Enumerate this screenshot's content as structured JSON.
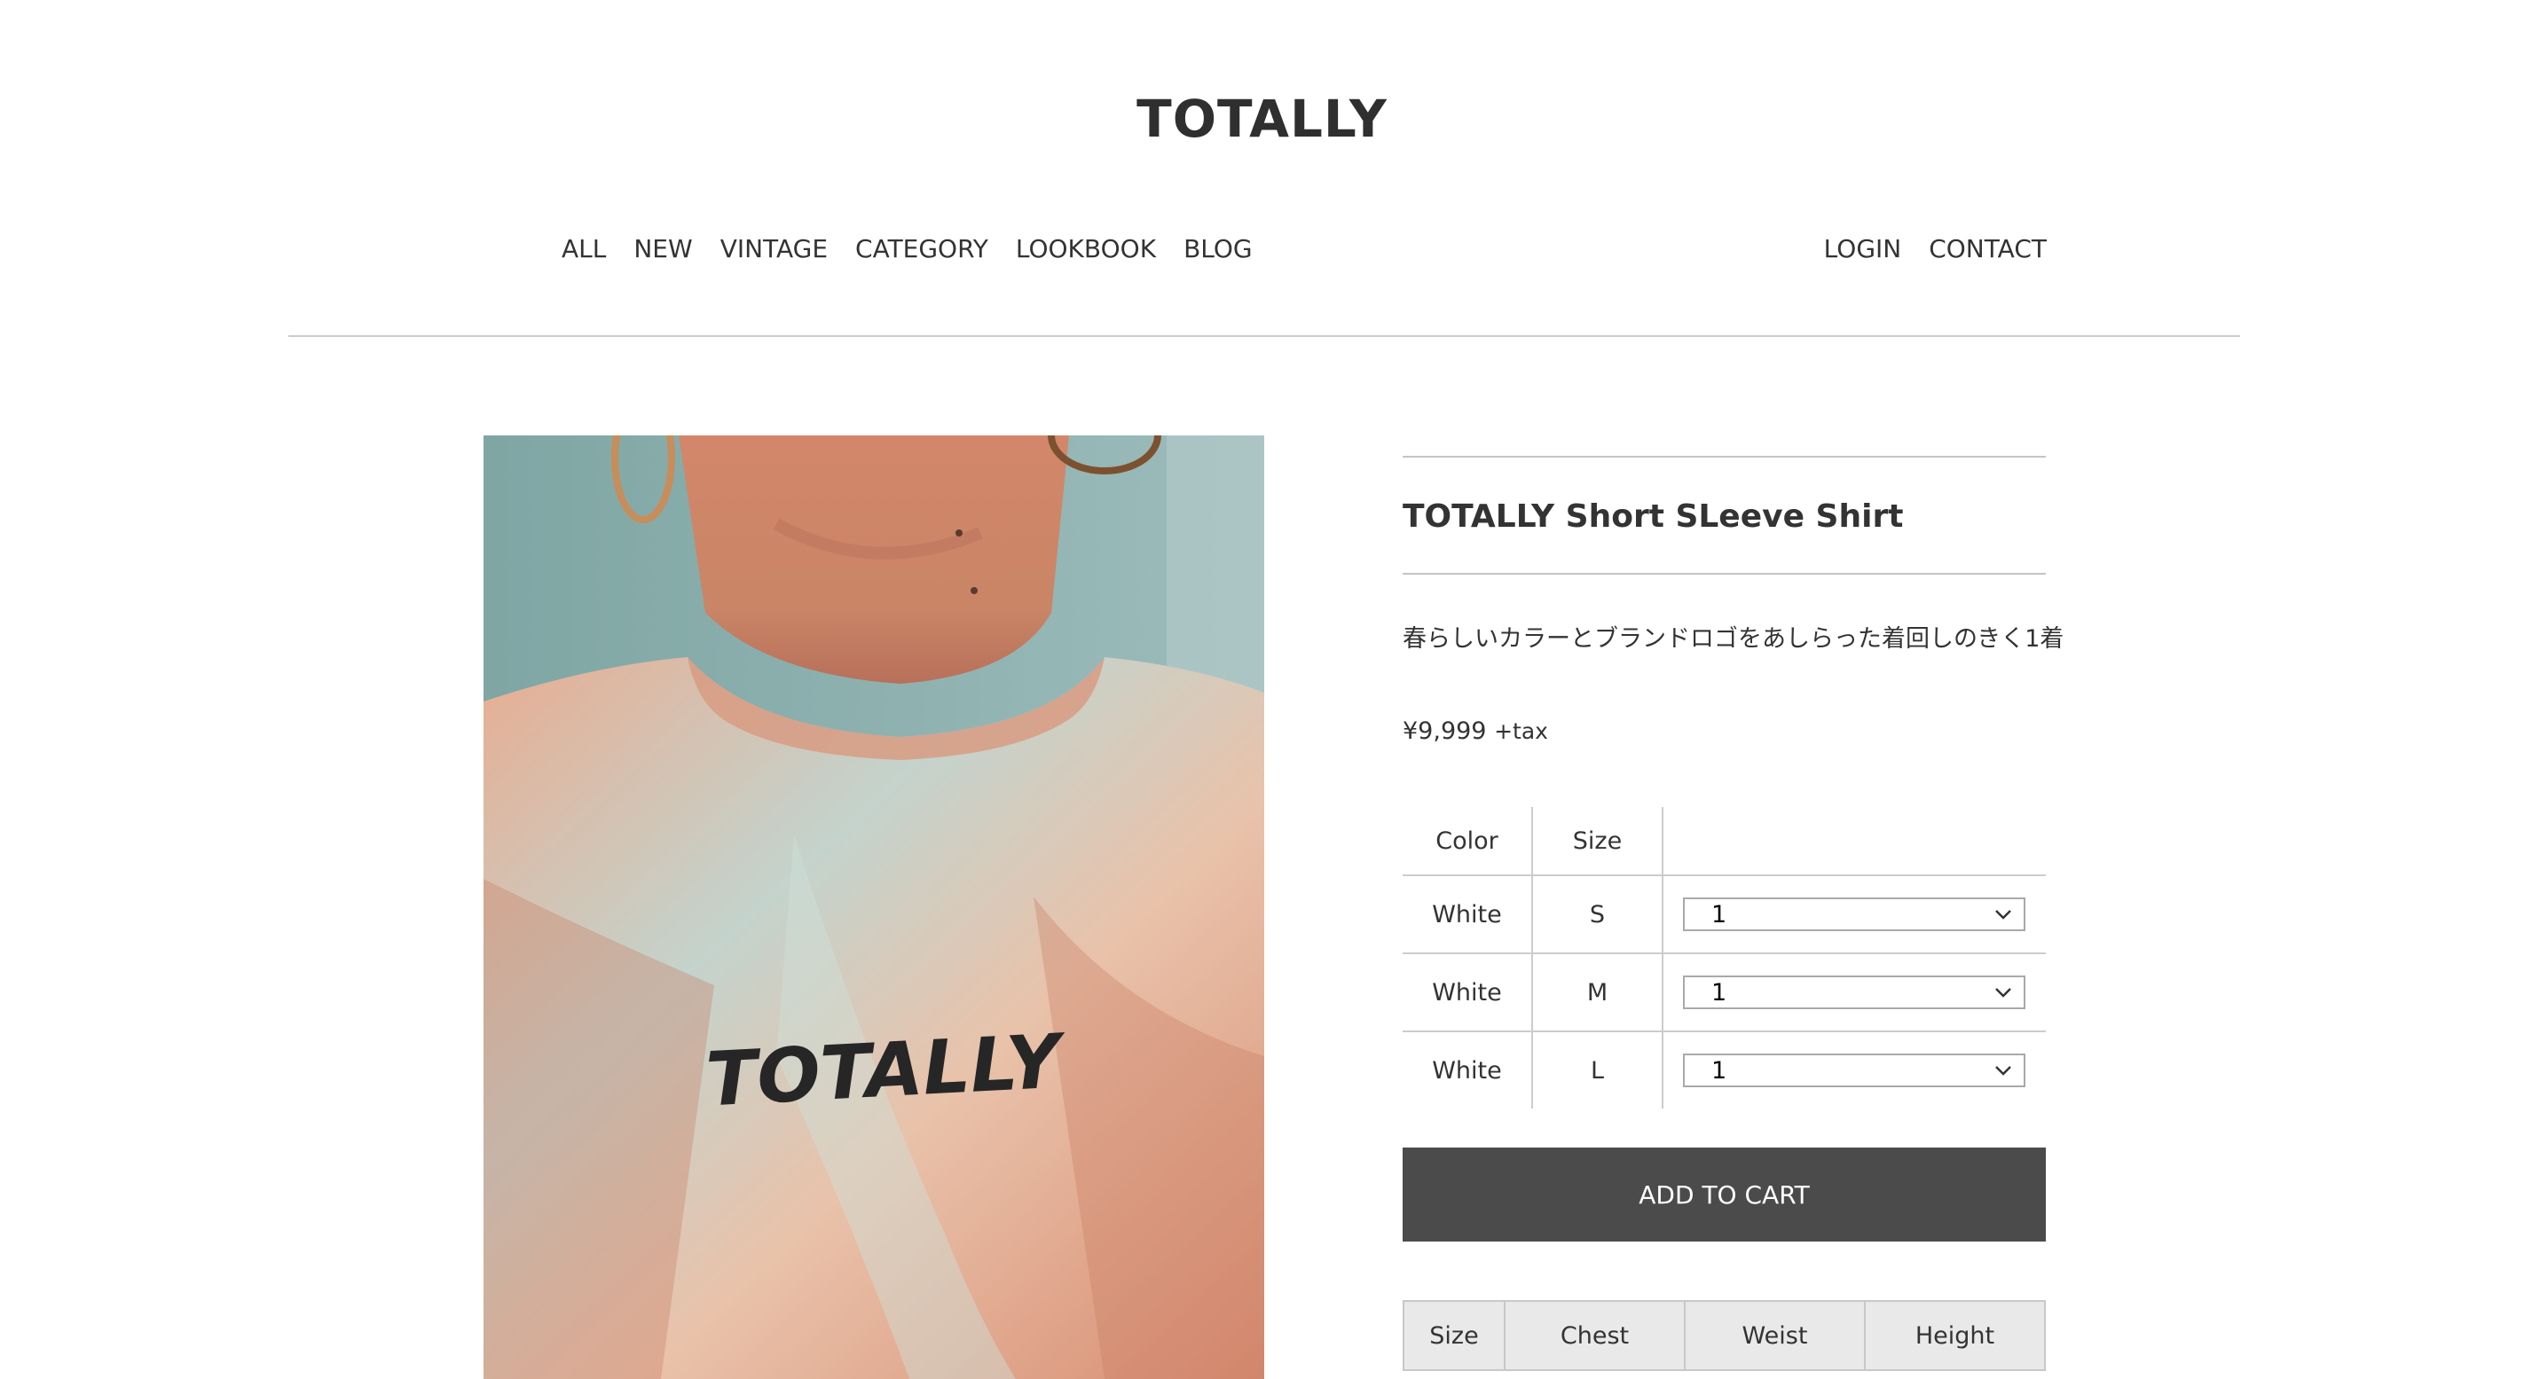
{
  "header": {
    "logo": "TOTALLY",
    "nav_left": [
      "ALL",
      "NEW",
      "VINTAGE",
      "CATEGORY",
      "LOOKBOOK",
      "BLOG"
    ],
    "nav_right": [
      "LOGIN",
      "CONTACT"
    ]
  },
  "product": {
    "image_logo_text": "TOTALLY",
    "title": "TOTALLY Short SLeeve Shirt",
    "description": "春らしいカラーとブランドロゴをあしらった着回しのきく1着",
    "price": "¥9,999",
    "price_tax": "+tax",
    "variants": {
      "headers": [
        "Color",
        "Size"
      ],
      "rows": [
        {
          "color": "White",
          "size": "S",
          "qty": "1"
        },
        {
          "color": "White",
          "size": "M",
          "qty": "1"
        },
        {
          "color": "White",
          "size": "L",
          "qty": "1"
        }
      ]
    },
    "add_to_cart": "ADD TO CART",
    "size_chart": {
      "headers": [
        "Size",
        "Chest",
        "Weist",
        "Height"
      ]
    }
  },
  "icons": {
    "dropdown": "chevron-down-icon"
  },
  "colors": {
    "button_bg": "#4b4b4b",
    "text": "#333333",
    "rule": "#cccccc"
  }
}
